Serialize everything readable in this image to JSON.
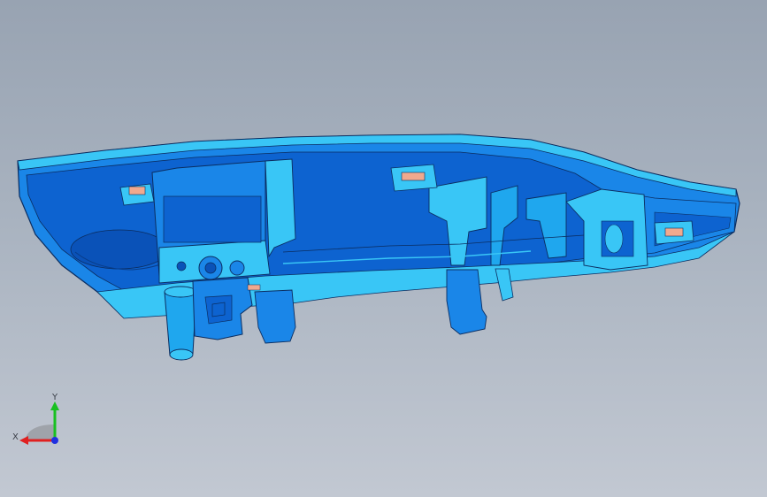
{
  "viewport": {
    "background_top": "#98a3b2",
    "background_bottom": "#c2c8d2"
  },
  "model": {
    "body_color": "#1a86e8",
    "highlight_color": "#39c6f6",
    "shadow_color": "#0a52b8",
    "edge_color": "#0b2d60",
    "pad_color": "#f0a98e"
  },
  "triad": {
    "x_label": "X",
    "y_label": "Y",
    "x_color": "#e02020",
    "y_color": "#18c020",
    "z_color": "#2030e0"
  }
}
